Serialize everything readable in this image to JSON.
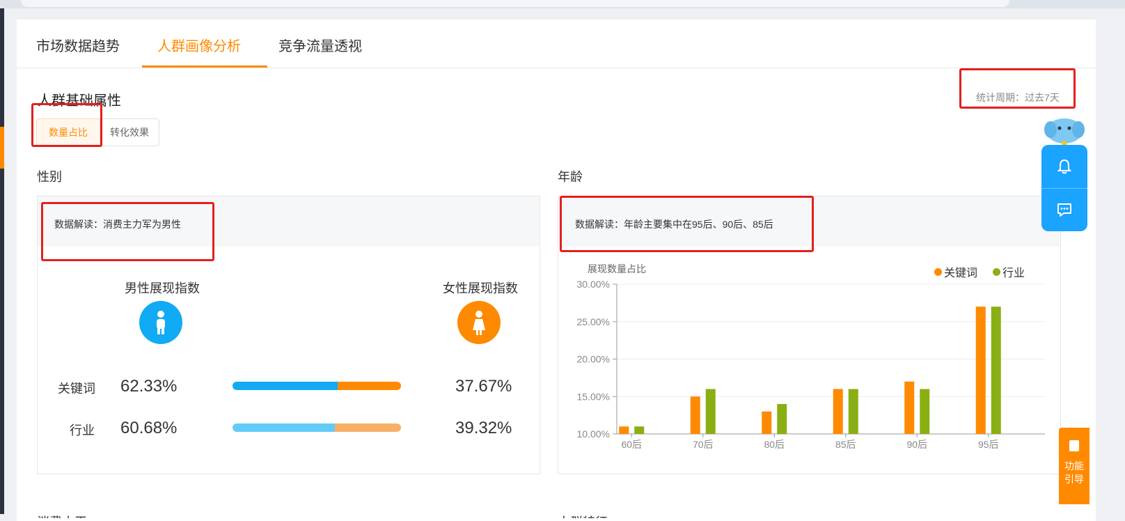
{
  "tabs": [
    {
      "label": "市场数据趋势"
    },
    {
      "label": "人群画像分析"
    },
    {
      "label": "竞争流量透视"
    }
  ],
  "section": {
    "title": "人群基础属性",
    "period": "统计周期：过去7天",
    "segments": [
      "数量占比",
      "转化效果"
    ]
  },
  "gender": {
    "label": "性别",
    "note": "数据解读：消费主力军为男性",
    "male_title": "男性展现指数",
    "female_title": "女性展现指数",
    "rows": [
      {
        "label": "关键词",
        "male": "62.33%",
        "female": "37.67%",
        "male_share": 62.33
      },
      {
        "label": "行业",
        "male": "60.68%",
        "female": "39.32%",
        "male_share": 60.68
      }
    ],
    "colors": {
      "male": "#11aaf5",
      "female": "#ff8a00",
      "male_light": "#63cbf8",
      "female_light": "#f8b066"
    }
  },
  "age": {
    "label": "年龄",
    "note": "数据解读：年龄主要集中在95后、90后、85后"
  },
  "chart_data": {
    "type": "bar",
    "title": "展现数量占比",
    "categories": [
      "60后",
      "70后",
      "80后",
      "85后",
      "90后",
      "95后"
    ],
    "series": [
      {
        "name": "关键词",
        "color": "#ff8a00",
        "values": [
          11,
          15,
          13,
          16,
          17,
          27
        ]
      },
      {
        "name": "行业",
        "color": "#8aaf12",
        "values": [
          11,
          16,
          14,
          16,
          16,
          27
        ]
      }
    ],
    "ylim": [
      10,
      30
    ],
    "yticks": [
      "10.00%",
      "15.00%",
      "20.00%",
      "25.00%",
      "30.00%"
    ],
    "legend": "top-right",
    "grid": true
  },
  "guide": {
    "label": "功能引导"
  },
  "cut_labels": [
    "消费水平",
    "人群特征"
  ]
}
